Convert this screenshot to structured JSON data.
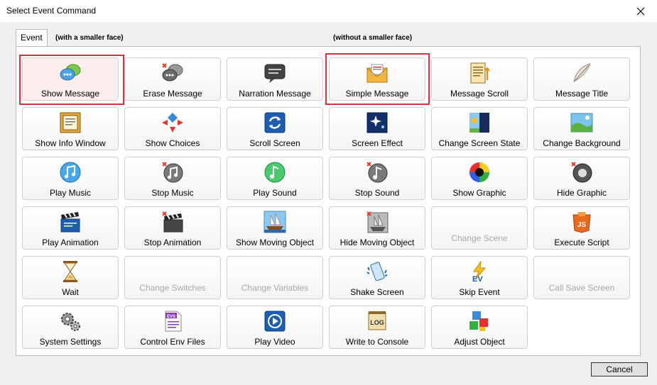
{
  "window": {
    "title": "Select Event Command"
  },
  "tabs": [
    {
      "label": "Event"
    }
  ],
  "notes": {
    "with_face": "(with a smaller face)",
    "without_face": "(without a smaller face)"
  },
  "commands": [
    {
      "label": "Show Message",
      "icon": "message-bubbles-icon",
      "enabled": true
    },
    {
      "label": "Erase Message",
      "icon": "erase-bubbles-icon",
      "enabled": true
    },
    {
      "label": "Narration Message",
      "icon": "narration-bubble-icon",
      "enabled": true
    },
    {
      "label": "Simple Message",
      "icon": "envelope-icon",
      "enabled": true
    },
    {
      "label": "Message Scroll",
      "icon": "scroll-document-icon",
      "enabled": true
    },
    {
      "label": "Message Title",
      "icon": "feather-icon",
      "enabled": true
    },
    {
      "label": "Show Info Window",
      "icon": "info-window-icon",
      "enabled": true
    },
    {
      "label": "Show Choices",
      "icon": "choices-arrows-icon",
      "enabled": true
    },
    {
      "label": "Scroll Screen",
      "icon": "scroll-screen-icon",
      "enabled": true
    },
    {
      "label": "Screen Effect",
      "icon": "screen-effect-icon",
      "enabled": true
    },
    {
      "label": "Change Screen State",
      "icon": "day-night-icon",
      "enabled": true
    },
    {
      "label": "Change Background",
      "icon": "landscape-icon",
      "enabled": true
    },
    {
      "label": "Play Music",
      "icon": "music-note-icon",
      "enabled": true
    },
    {
      "label": "Stop Music",
      "icon": "stop-music-icon",
      "enabled": true
    },
    {
      "label": "Play Sound",
      "icon": "sound-note-icon",
      "enabled": true
    },
    {
      "label": "Stop Sound",
      "icon": "stop-sound-icon",
      "enabled": true
    },
    {
      "label": "Show Graphic",
      "icon": "color-wheel-icon",
      "enabled": true
    },
    {
      "label": "Hide Graphic",
      "icon": "hide-graphic-icon",
      "enabled": true
    },
    {
      "label": "Play Animation",
      "icon": "clapperboard-icon",
      "enabled": true
    },
    {
      "label": "Stop Animation",
      "icon": "stop-clapperboard-icon",
      "enabled": true
    },
    {
      "label": "Show Moving Object",
      "icon": "ship-icon",
      "enabled": true
    },
    {
      "label": "Hide Moving Object",
      "icon": "hide-ship-icon",
      "enabled": true
    },
    {
      "label": "Change Scene",
      "icon": "",
      "enabled": false
    },
    {
      "label": "Execute Script",
      "icon": "js-script-icon",
      "enabled": true
    },
    {
      "label": "Wait",
      "icon": "hourglass-icon",
      "enabled": true
    },
    {
      "label": "Change Switches",
      "icon": "",
      "enabled": false
    },
    {
      "label": "Change Variables",
      "icon": "",
      "enabled": false
    },
    {
      "label": "Shake Screen",
      "icon": "shaking-phone-icon",
      "enabled": true
    },
    {
      "label": "Skip Event",
      "icon": "ev-lightning-icon",
      "enabled": true
    },
    {
      "label": "Call Save Screen",
      "icon": "",
      "enabled": false
    },
    {
      "label": "System Settings",
      "icon": "gears-icon",
      "enabled": true
    },
    {
      "label": "Control Env Files",
      "icon": "evs-file-icon",
      "enabled": true
    },
    {
      "label": "Play Video",
      "icon": "video-play-icon",
      "enabled": true
    },
    {
      "label": "Write to Console",
      "icon": "log-console-icon",
      "enabled": true
    },
    {
      "label": "Adjust Object",
      "icon": "color-blocks-icon",
      "enabled": true
    }
  ],
  "buttons": {
    "cancel": "Cancel"
  },
  "colors": {
    "highlight": "#d9333f",
    "panel": "#ffffff",
    "dialog": "#f0f0f0",
    "disabled_text": "#a8a8a8"
  }
}
